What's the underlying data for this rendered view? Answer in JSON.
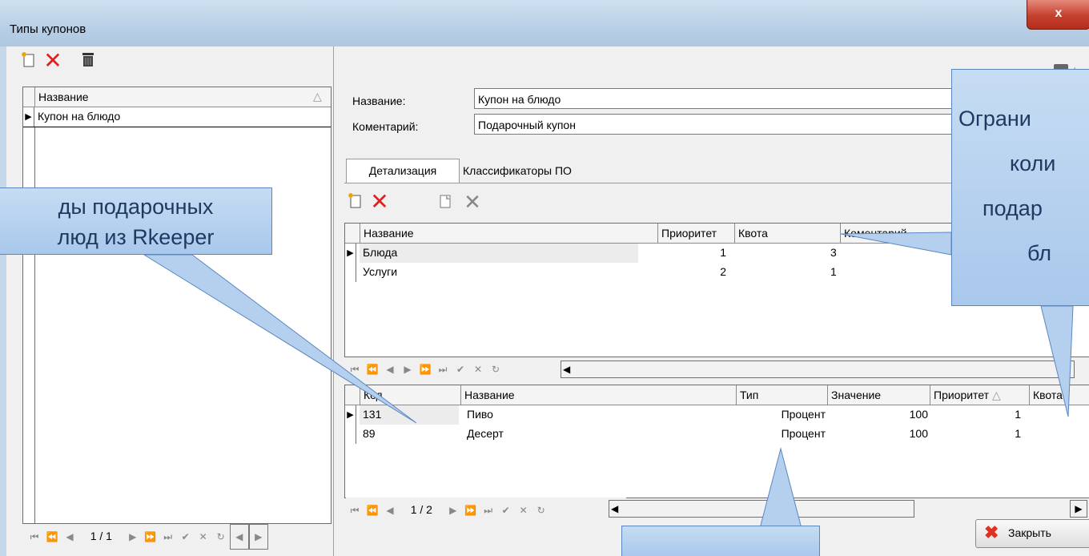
{
  "window": {
    "title": "Типы купонов",
    "close_glyph": "x",
    "bg_color": "#c5d8ea"
  },
  "left": {
    "toolbar_icons": [
      "new-doc-icon",
      "delete-x-icon",
      "trash-icon"
    ],
    "grid": {
      "header": "Название",
      "sort_glyph": "△",
      "rows": [
        {
          "name": "Купон на блюдо",
          "current": true
        }
      ]
    },
    "nav": {
      "page": "1 / 1"
    }
  },
  "form": {
    "name_label": "Название:",
    "name_value": "Купон на блюдо",
    "comment_label": "Коментарий:",
    "comment_value": "Подарочный купон"
  },
  "tabs": [
    {
      "label": "Детализация",
      "active": true
    },
    {
      "label": "Классификаторы ПО",
      "active": false
    }
  ],
  "detail_grid": {
    "columns": [
      "Название",
      "Приоритет",
      "Квота",
      "Коментарий"
    ],
    "rows": [
      {
        "name": "Блюда",
        "priority": "1",
        "quota": "3",
        "current": true
      },
      {
        "name": "Услуги",
        "priority": "2",
        "quota": "1",
        "current": false
      }
    ]
  },
  "dish_grid": {
    "columns": [
      "Код",
      "Название",
      "Тип",
      "Значение",
      "Приоритет",
      "Квота"
    ],
    "sort_glyph": "△",
    "rows": [
      {
        "code": "131",
        "name": "Пиво",
        "type": "Процент",
        "value": "100",
        "priority": "1",
        "current": true
      },
      {
        "code": "89",
        "name": "Десерт",
        "type": "Процент",
        "value": "100",
        "priority": "1",
        "current": false
      }
    ],
    "nav": {
      "page": "1 / 2"
    }
  },
  "close_button": {
    "label": "Закрыть",
    "icon": "close-x-icon"
  },
  "callouts": {
    "left_line1": "ды подарочных",
    "left_line2": "люд из Rkeeper",
    "right_line1": "Ограни",
    "right_line2": "коли",
    "right_line3": "подар",
    "right_line4": "бл"
  }
}
